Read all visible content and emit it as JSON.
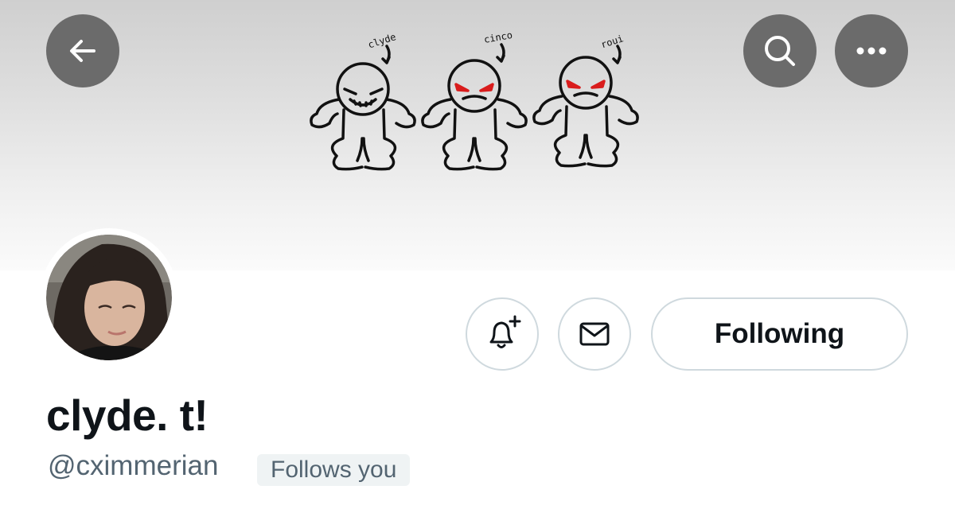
{
  "profile": {
    "display_name": "clyde. t!",
    "handle": "@cximmerian",
    "follows_you_label": "Follows you"
  },
  "banner": {
    "character_labels": [
      "clyde",
      "cinco",
      "roui"
    ]
  },
  "actions": {
    "following_label": "Following"
  },
  "icons": {
    "back": "arrow-left-icon",
    "search": "search-icon",
    "more": "more-horizontal-icon",
    "notify": "bell-plus-icon",
    "message": "envelope-icon"
  },
  "colors": {
    "nav_button_bg": "#6b6b6b",
    "text_primary": "#0f1419",
    "text_secondary": "#536471",
    "button_border": "#cfd9de",
    "badge_bg": "#eff3f4",
    "eye_red": "#d91c1c"
  }
}
